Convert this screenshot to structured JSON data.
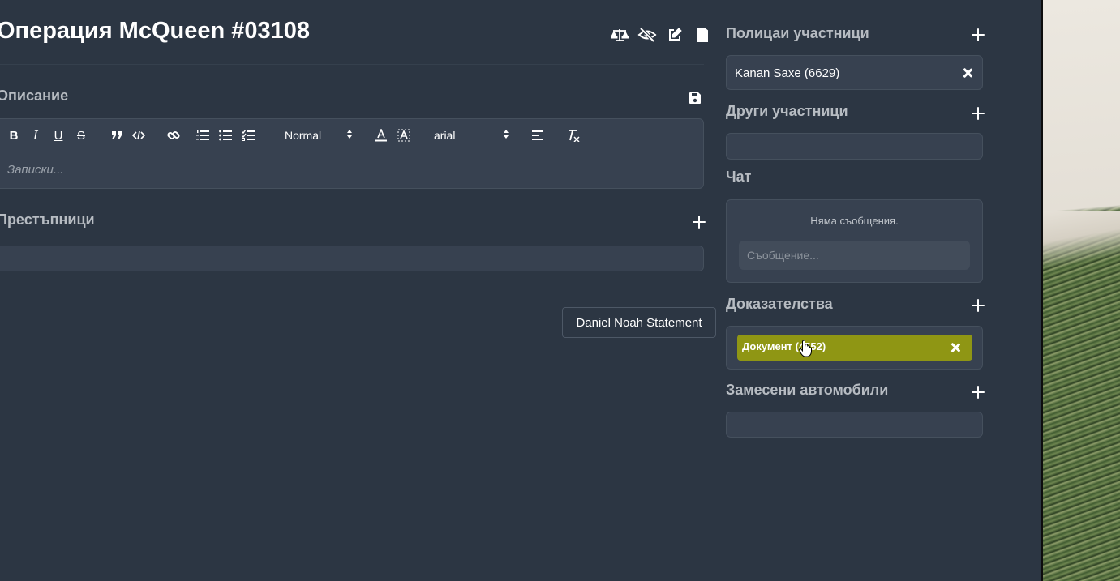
{
  "header": {
    "title": "Операция McQueen #03108",
    "icons": [
      "scales-icon",
      "eye-slash-icon",
      "edit-icon",
      "file-icon"
    ]
  },
  "description": {
    "title": "Описание",
    "editor": {
      "toolbar": {
        "bold": "B",
        "italic": "I",
        "underline": "U",
        "strike": "S",
        "size_value": "Normal",
        "font_value": "arial"
      },
      "placeholder": "Записки..."
    }
  },
  "criminals": {
    "title": "Престъпници"
  },
  "tooltip": {
    "text": "Daniel Noah Statement"
  },
  "officers": {
    "title": "Полицаи участници",
    "items": [
      {
        "label": "Kanan Saxe (6629)"
      }
    ]
  },
  "others": {
    "title": "Други участници"
  },
  "chat": {
    "title": "Чат",
    "empty_text": "Няма съобщения.",
    "input_placeholder": "Съобщение..."
  },
  "evidence": {
    "title": "Доказателства",
    "items": [
      {
        "label": "Документ (4552)",
        "color": "#8f9614"
      }
    ]
  },
  "vehicles": {
    "title": "Замесени автомобили"
  },
  "colors": {
    "background": "#2c3643",
    "panel": "#374150",
    "evidence_chip": "#8f9614"
  }
}
